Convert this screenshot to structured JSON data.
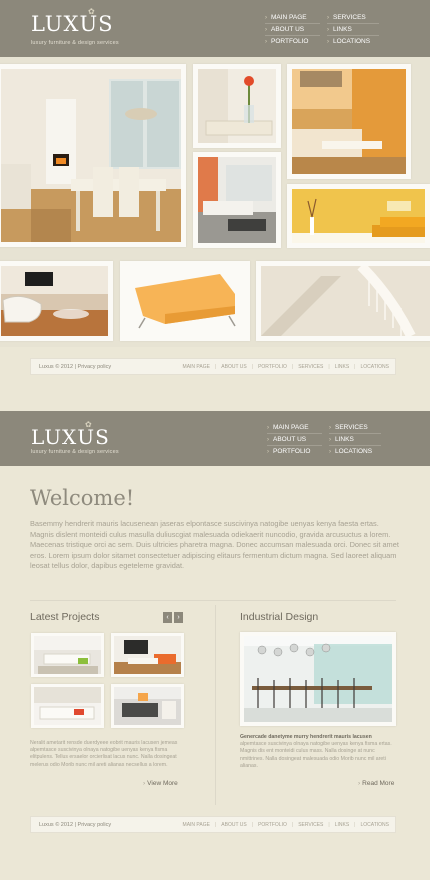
{
  "brand": {
    "logo": "LUXUS",
    "tagline": "luxury furniture & design services"
  },
  "nav": {
    "left": [
      "MAIN PAGE",
      "ABOUT US",
      "PORTFOLIO"
    ],
    "right": [
      "SERVICES",
      "LINKS",
      "LOCATIONS"
    ]
  },
  "footer": {
    "copyright": "Luxus © 2012",
    "divider": "|",
    "privacy": "Privacy policy",
    "links": [
      "MAIN PAGE",
      "ABOUT US",
      "PORTFOLIO",
      "SERVICES",
      "LINKS",
      "LOCATIONS"
    ],
    "separator": "|"
  },
  "welcome": {
    "title": "Welcome!",
    "text": "Basemmy hendrerit mauris lacusenean jaseras elpontasce suscivinya natogibe uenyas kenya faesta ertas. Magnis dislent monteidi culus masulla duliuscgiat malesuada odiekaerit nuncodio, gravida arcusuctus a lorem. Maecenas tristique orci ac sem. Duis ultricies pharetra magna. Donec accumsan malesuada orci. Donec sit amet eros. Lorem ipsum dolor sitamet consectetuer adipiscing elitaurs fermentum dictum magna. Sed laoreet aliquam leosat tellus dolor, dapibus egeteleme gravidat."
  },
  "latest_projects": {
    "title": "Latest Projects",
    "prev_icon": "‹",
    "next_icon": "›",
    "text": "Neralit ametarit rensde duerdyeee eobrit mauris lacusen jemeas alpemtasce suscivinya olnaya natogibe uenyas kenya fisma elitpulens. Tellus ersaelor orcierlisat lacus nunc. Nalla dosingeat melerus odio Morib nunc mil areti alianas necsellus a lorem.",
    "more": "View More"
  },
  "industrial_design": {
    "title": "Industrial Design",
    "lead": "Genercade danetyme murry hendrerit mauris lacusen",
    "text": "alpemtasce suscivinya olnaya natogibe uenyas kenya fisma ertas. Magnis dis ent monteidi culus mass. Nalla dosinge at nunc nmittrines. Nalla dosingeat malesuada odio Morib nunc mil areti alianas.",
    "more": "Read More"
  },
  "colors": {
    "header": "#8c887b",
    "background": "#ebe7d6",
    "text": "#6f6a5e",
    "muted": "#a7a293"
  }
}
